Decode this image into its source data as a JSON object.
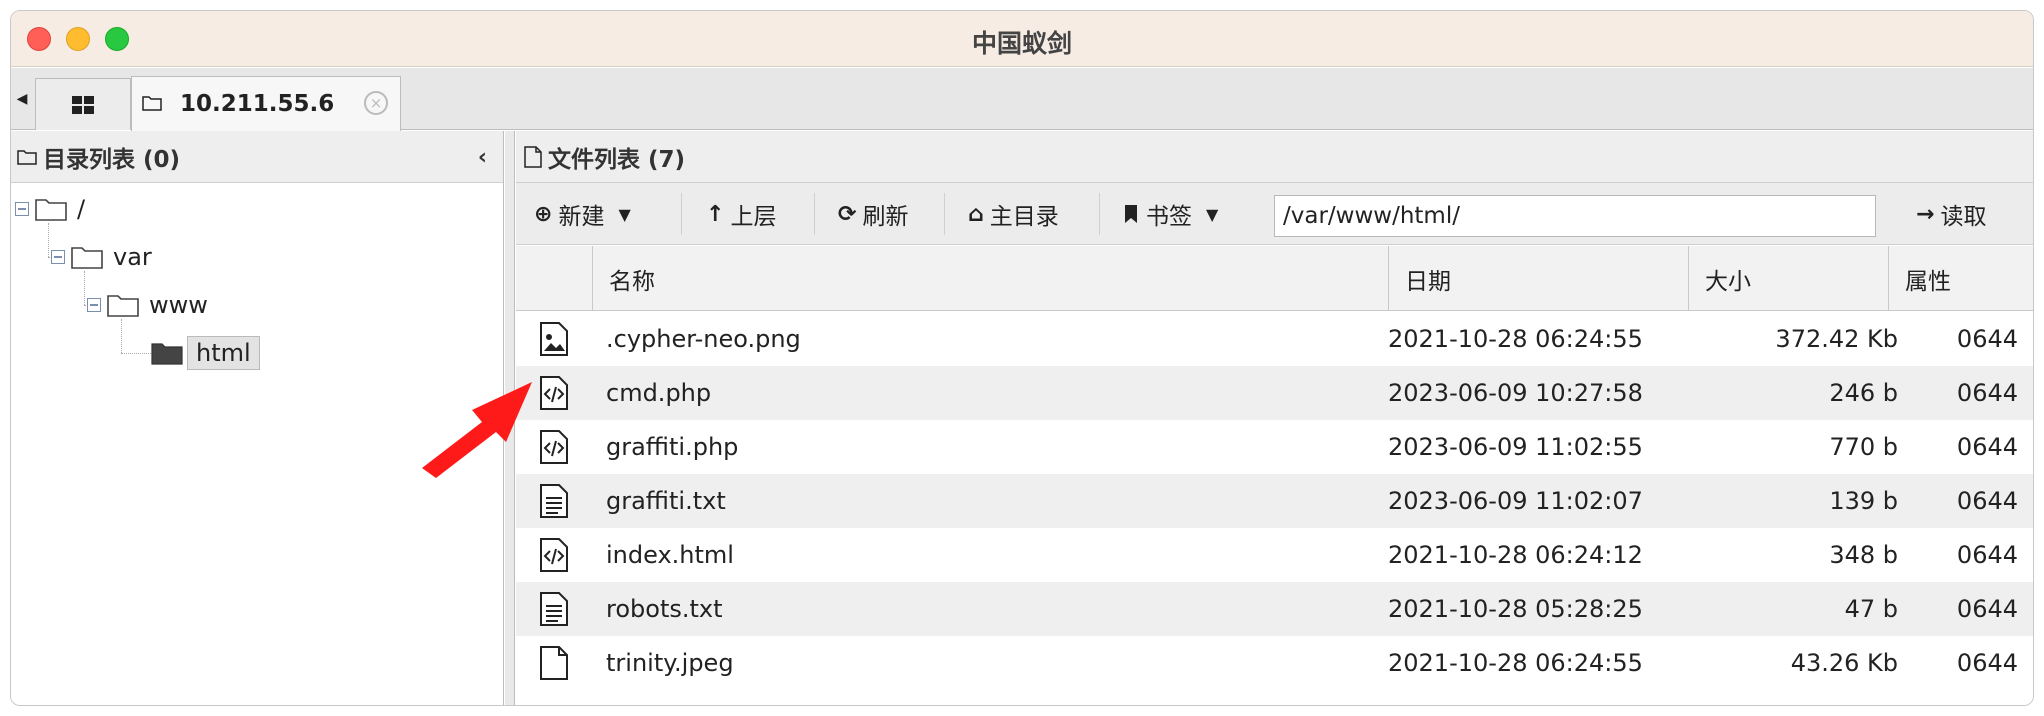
{
  "window": {
    "title": "中国蚁剑"
  },
  "tabs": {
    "active_label": "10.211.55.6",
    "close_glyph": "×"
  },
  "left_panel": {
    "title": "目录列表 (0)",
    "tree": [
      {
        "label": "/"
      },
      {
        "label": "var"
      },
      {
        "label": "www"
      },
      {
        "label": "html",
        "selected": true
      }
    ]
  },
  "right_panel": {
    "title": "文件列表 (7)",
    "toolbar": {
      "new_label": "新建",
      "up_label": "上层",
      "refresh_label": "刷新",
      "home_label": "主目录",
      "bookmark_label": "书签",
      "path_value": "/var/www/html/",
      "read_label": "读取"
    },
    "columns": [
      "名称",
      "日期",
      "大小",
      "属性"
    ],
    "files": [
      {
        "icon": "image-file-icon",
        "name": ".cypher-neo.png",
        "date": "2021-10-28 06:24:55",
        "size": "372.42 Kb",
        "perm": "0644"
      },
      {
        "icon": "code-file-icon",
        "name": "cmd.php",
        "date": "2023-06-09 10:27:58",
        "size": "246 b",
        "perm": "0644"
      },
      {
        "icon": "code-file-icon",
        "name": "graffiti.php",
        "date": "2023-06-09 11:02:55",
        "size": "770 b",
        "perm": "0644"
      },
      {
        "icon": "text-file-icon",
        "name": "graffiti.txt",
        "date": "2023-06-09 11:02:07",
        "size": "139 b",
        "perm": "0644"
      },
      {
        "icon": "code-file-icon",
        "name": "index.html",
        "date": "2021-10-28 06:24:12",
        "size": "348 b",
        "perm": "0644"
      },
      {
        "icon": "text-file-icon",
        "name": "robots.txt",
        "date": "2021-10-28 05:28:25",
        "size": "47 b",
        "perm": "0644"
      },
      {
        "icon": "blank-file-icon",
        "name": "trinity.jpeg",
        "date": "2021-10-28 06:24:55",
        "size": "43.26 Kb",
        "perm": "0644"
      }
    ]
  },
  "colors": {
    "annotation_arrow": "#ff1a1a",
    "titlebar_bg": "#f6ece4"
  }
}
